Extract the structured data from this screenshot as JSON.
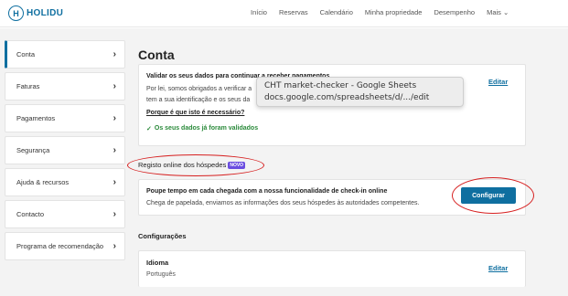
{
  "brand": {
    "logo_glyph": "H",
    "name": "HOLIDU",
    "color": "#0f6fa0"
  },
  "nav": {
    "items": [
      "Início",
      "Reservas",
      "Calendário",
      "Minha propriedade",
      "Desempenho",
      "Mais ⌄"
    ]
  },
  "sidebar": {
    "items": [
      {
        "label": "Conta",
        "active": true
      },
      {
        "label": "Faturas"
      },
      {
        "label": "Pagamentos"
      },
      {
        "label": "Segurança"
      },
      {
        "label": "Ajuda & recursos"
      },
      {
        "label": "Contacto"
      },
      {
        "label": "Programa de recomendação"
      }
    ],
    "chevron": "›"
  },
  "main": {
    "title": "Conta",
    "validate_card": {
      "title": "Validar os seus dados para continuar a receber pagamentos",
      "line1": "Por lei, somos obrigados a verificar a",
      "line2": "tem a sua identificação e os seus da",
      "link": "Porque é que isto é necessário?",
      "ok_icon": "✓",
      "ok_text": "Os seus dados já foram validados",
      "edit_label": "Editar"
    },
    "tooltip": {
      "line1": "CHT market-checker - Google Sheets",
      "line2": "docs.google.com/spreadsheets/d/.../edit"
    },
    "checkin_section": {
      "label": "Registo online dos hóspedes",
      "badge": "NOVO"
    },
    "checkin_card": {
      "title": "Poupe tempo em cada chegada com a nossa funcionalidade de check-in online",
      "desc": "Chega de papelada, enviamos as informações dos seus hóspedes às autoridades competentes.",
      "button": "Configurar"
    },
    "settings_section": {
      "label": "Configurações"
    },
    "language_card": {
      "title": "Idioma",
      "value": "Português",
      "edit_label": "Editar"
    }
  },
  "annotation_color": "#d61f1f"
}
